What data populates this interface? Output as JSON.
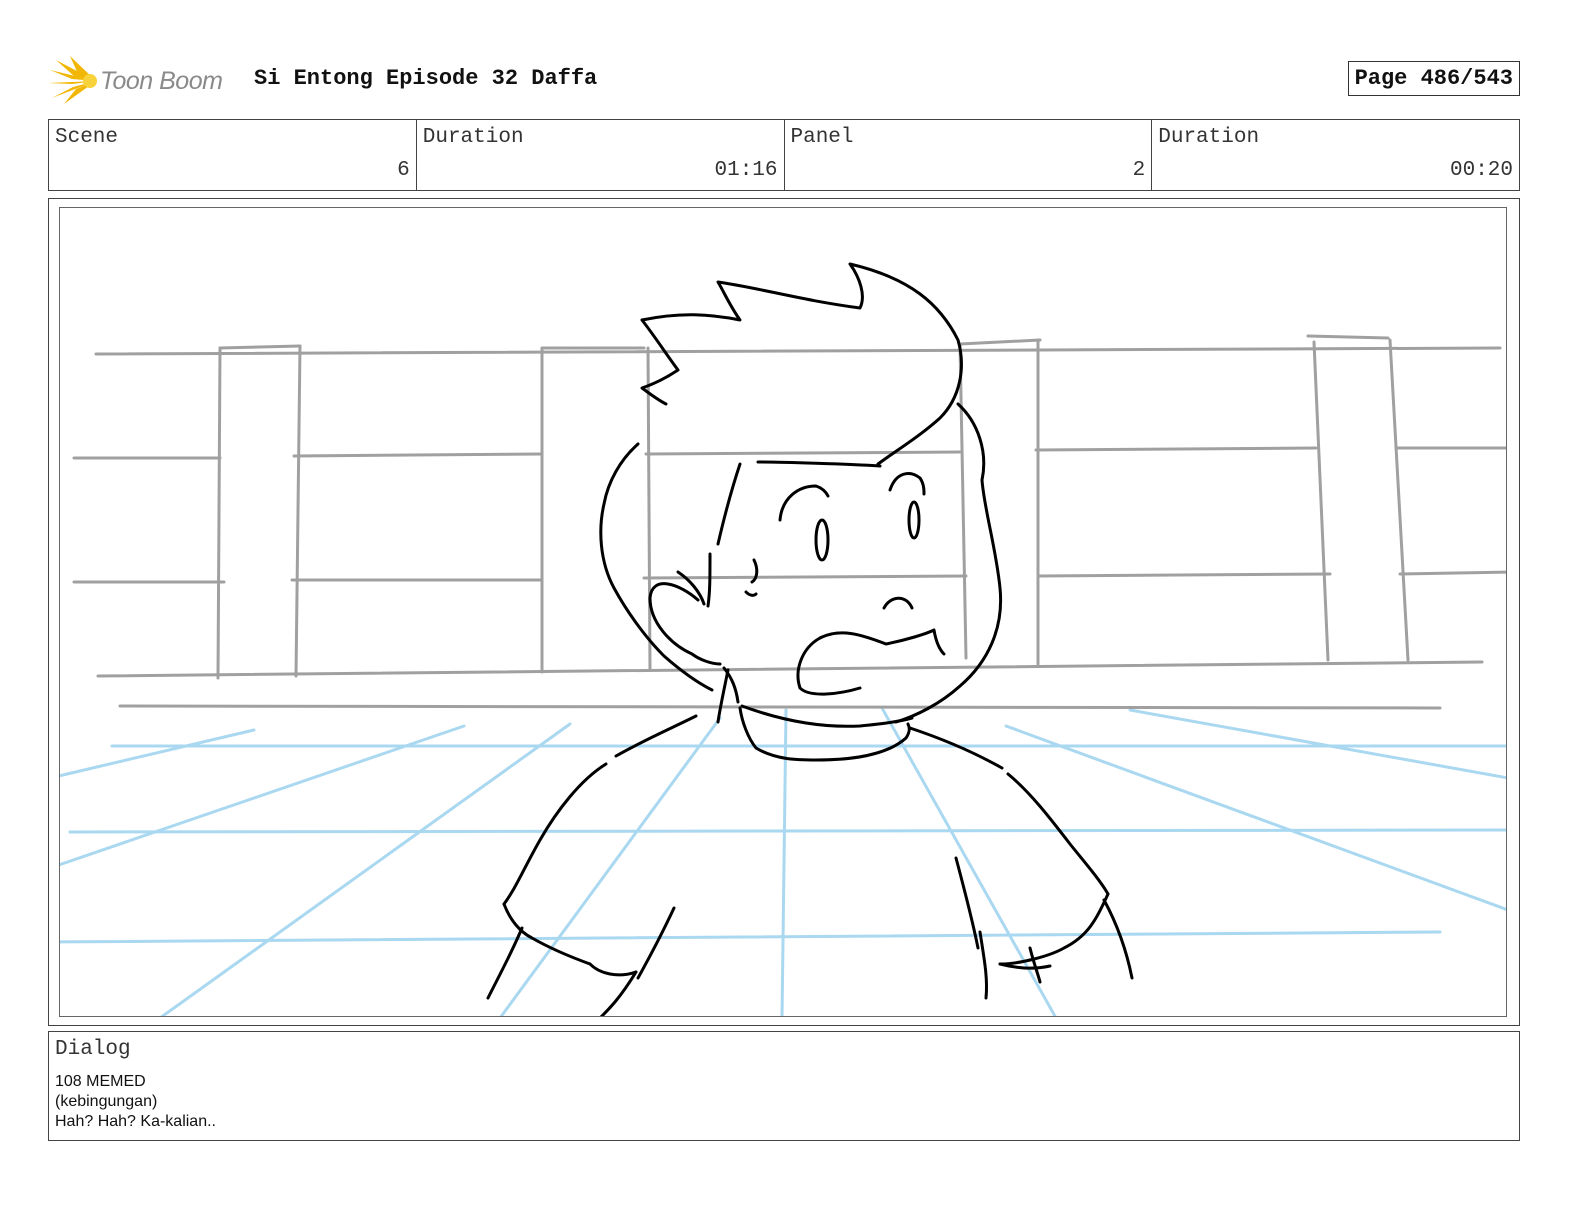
{
  "header": {
    "logo_text": "Toon Boom",
    "title": "Si Entong Episode 32 Daffa",
    "page": "Page 486/543"
  },
  "info": {
    "scene_label": "Scene",
    "scene_value": "6",
    "scene_duration_label": "Duration",
    "scene_duration_value": "01:16",
    "panel_label": "Panel",
    "panel_value": "2",
    "panel_duration_label": "Duration",
    "panel_duration_value": "00:20"
  },
  "dialog": {
    "label": "Dialog",
    "lines": [
      "108 MEMED",
      "(kebingungan)",
      "Hah? Hah? Ka-kalian.."
    ]
  },
  "colors": {
    "perspective_lines": "#a9d8f0",
    "background_lines": "#a0a0a0",
    "character_lines": "#000000",
    "logo_burst": "#f2b705"
  }
}
